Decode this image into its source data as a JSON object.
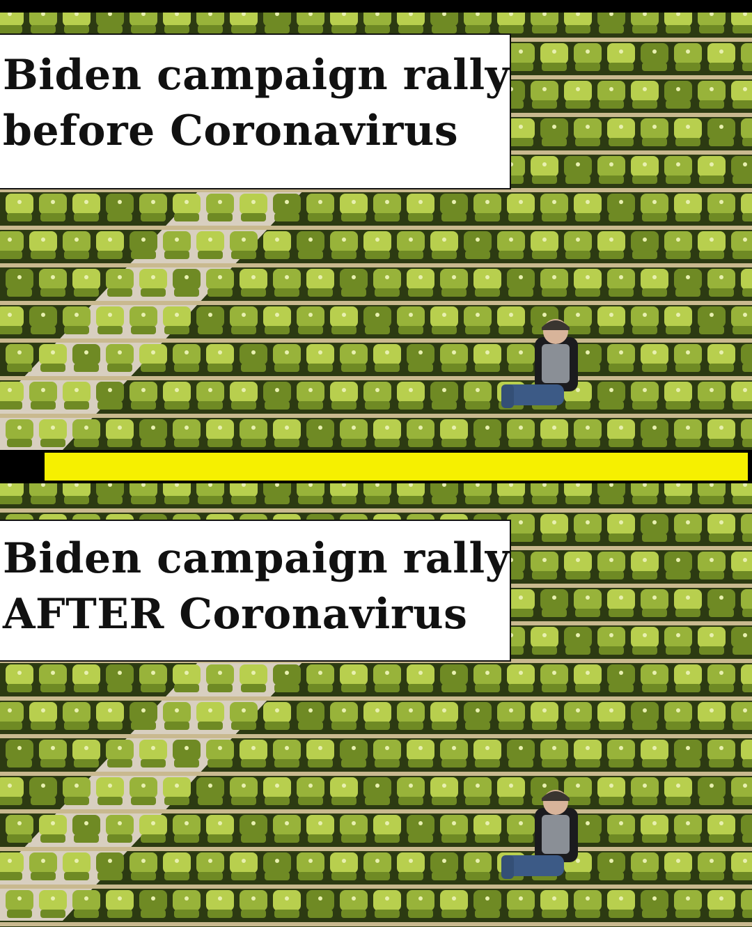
{
  "panels": [
    {
      "caption_line1": "Biden campaign rally",
      "caption_line2": "before Coronavirus"
    },
    {
      "caption_line1": "Biden campaign rally",
      "caption_line2": "AFTER Coronavirus"
    }
  ],
  "colors": {
    "seat_light": "#b8cf4e",
    "seat_mid": "#98b33a",
    "seat_dark": "#6f8a24",
    "stairs": "#d8cfc0",
    "divider": "#f6f000",
    "background": "#000000"
  },
  "image_elements": [
    "stadium-seats",
    "lone-spectator"
  ]
}
